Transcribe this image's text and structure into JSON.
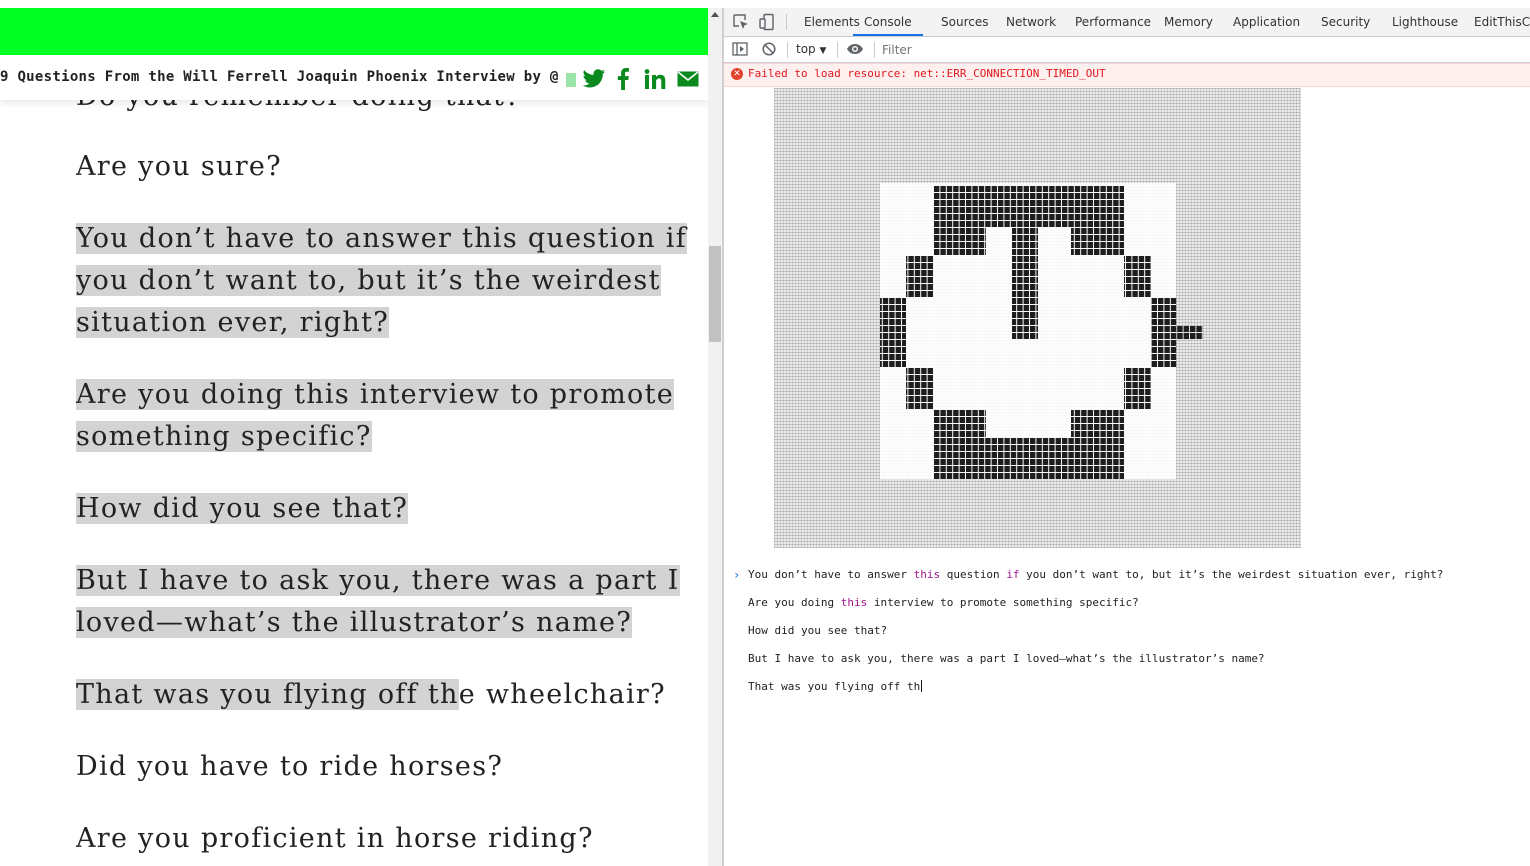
{
  "page": {
    "headline": "9 Questions From the Will Ferrell Joaquin Phoenix Interview by @",
    "share_icons": [
      "twitter-icon",
      "facebook-icon",
      "linkedin-icon",
      "email-icon"
    ],
    "green_color": "#00ff22",
    "questions": [
      {
        "lines": [
          "Do you remember doing that?"
        ],
        "highlight": false
      },
      {
        "lines": [
          "Are you sure?"
        ],
        "highlight": false
      },
      {
        "lines": [
          "You don’t have to answer this question if",
          "you don’t want to, but it’s the weirdest",
          "situation ever, right?"
        ],
        "highlight": true
      },
      {
        "lines": [
          "Are you doing this interview to promote",
          "something specific?"
        ],
        "highlight": true
      },
      {
        "lines": [
          "How did you see that?"
        ],
        "highlight": true
      },
      {
        "lines": [
          "But I have to ask you, there was a part I",
          "loved—what’s the illustrator’s name?"
        ],
        "highlight": true
      },
      {
        "lines": [
          "That was you flying off the wheelchair?"
        ],
        "highlight": "partial",
        "highlight_part": "That was you flying off th",
        "rest": "e wheelchair?"
      },
      {
        "lines": [
          "Did you have to ride horses?"
        ],
        "highlight": false
      },
      {
        "lines": [
          "Are you proficient in horse riding?"
        ],
        "highlight": false
      }
    ]
  },
  "devtools": {
    "tabs": [
      "Elements",
      "Console",
      "Sources",
      "Network",
      "Performance",
      "Memory",
      "Application",
      "Security",
      "Lighthouse",
      "EditThisCo"
    ],
    "active_tab": "Console",
    "context": "top",
    "filter_placeholder": "Filter",
    "error": "Failed to load resource: net::ERR_CONNECTION_TIMED_OUT",
    "accent": "#1a73e8",
    "error_color": "#e0181e",
    "keyword_color": "#a0168d",
    "logs": [
      {
        "parts": [
          {
            "t": "You don’t have to answer "
          },
          {
            "t": "this",
            "kw": true
          },
          {
            "t": " question "
          },
          {
            "t": "if",
            "kw": true
          },
          {
            "t": " you don’t want to, but it’s the weirdest situation ever, right?"
          }
        ]
      },
      {
        "parts": [
          {
            "t": "Are you doing "
          },
          {
            "t": "this",
            "kw": true
          },
          {
            "t": " interview to promote something specific?"
          }
        ]
      },
      {
        "parts": [
          {
            "t": "How did you see that?"
          }
        ]
      },
      {
        "parts": [
          {
            "t": "But I have to ask you, there was a part I loved—what’s the illustrator’s name?"
          }
        ]
      },
      {
        "parts": [
          {
            "t": "That was you flying off th"
          }
        ],
        "cursor": true
      }
    ]
  }
}
